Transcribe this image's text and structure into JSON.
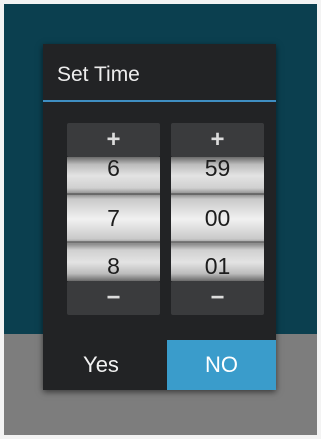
{
  "dialog": {
    "title": "Set Time",
    "hour": {
      "increment": "+",
      "decrement": "−",
      "prev": "6",
      "current": "7",
      "next": "8"
    },
    "minute": {
      "increment": "+",
      "decrement": "−",
      "prev": "59",
      "current": "00",
      "next": "01"
    },
    "buttons": {
      "yes": "Yes",
      "no": "NO"
    }
  },
  "colors": {
    "background_top": "#0b3f4f",
    "background_bottom": "#7d7d7d",
    "dialog": "#222325",
    "accent": "#3a9ccb"
  }
}
